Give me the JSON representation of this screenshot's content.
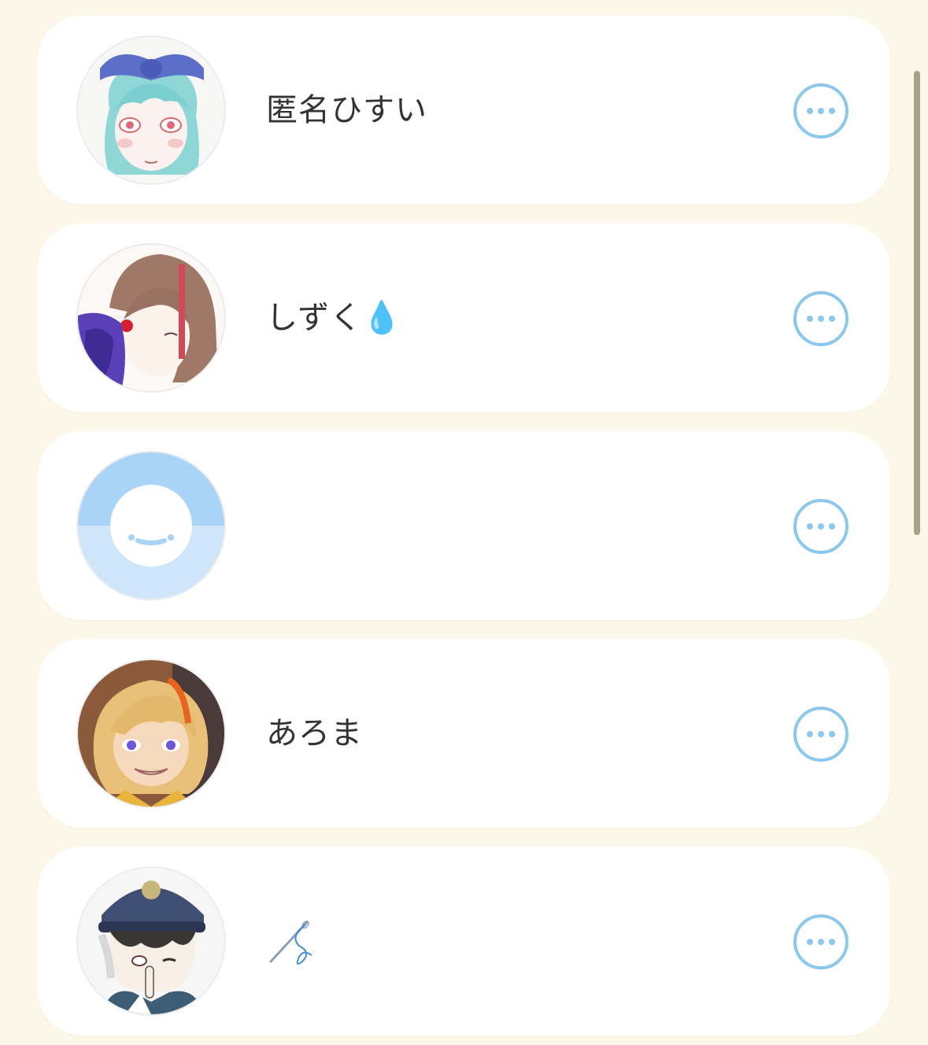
{
  "colors": {
    "background": "#fdf7ea",
    "card": "#ffffff",
    "accent": "#8cc8ec",
    "text": "#333333"
  },
  "users": [
    {
      "name": "匿名ひすい",
      "avatar": "anime-avatar-blue-hair-bow",
      "more_icon": "more-horizontal-icon"
    },
    {
      "name": "しずく💧",
      "avatar": "anime-avatar-brown-hair",
      "more_icon": "more-horizontal-icon"
    },
    {
      "name": "",
      "avatar": "default-smile-avatar",
      "more_icon": "more-horizontal-icon"
    },
    {
      "name": "あろま",
      "avatar": "anime-avatar-blonde-hair",
      "more_icon": "more-horizontal-icon"
    },
    {
      "name": "",
      "name_icon": "needle-thread-icon",
      "avatar": "anime-avatar-cap",
      "more_icon": "more-horizontal-icon"
    }
  ]
}
